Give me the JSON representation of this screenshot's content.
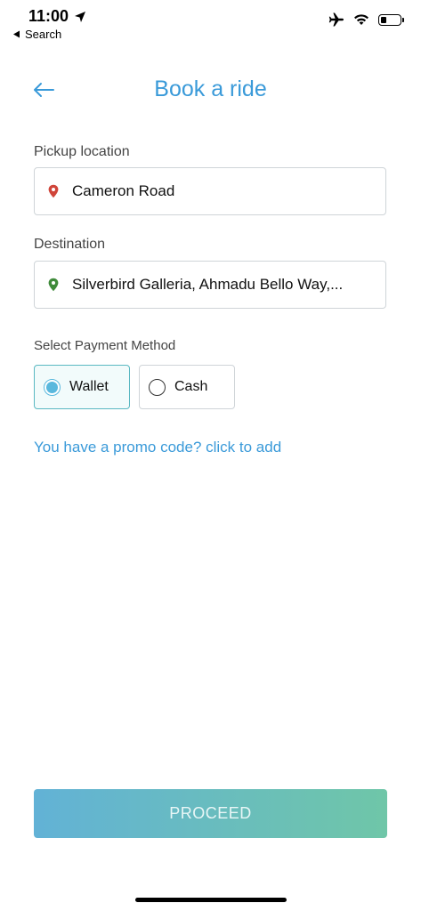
{
  "status_bar": {
    "time": "11:00",
    "back_app_label": "Search",
    "battery_level": 0.3
  },
  "header": {
    "title": "Book a ride"
  },
  "pickup": {
    "label": "Pickup location",
    "value": "Cameron Road",
    "pin_color": "#d0453a"
  },
  "destination": {
    "label": "Destination",
    "value": "Silverbird Galleria, Ahmadu Bello Way,...",
    "pin_color": "#3f8a3a"
  },
  "payment": {
    "label": "Select Payment Method",
    "options": [
      {
        "label": "Wallet",
        "selected": true
      },
      {
        "label": "Cash",
        "selected": false
      }
    ]
  },
  "promo": {
    "link_text": "You have a promo code? click to add"
  },
  "actions": {
    "proceed_label": "PROCEED"
  },
  "colors": {
    "accent": "#3a9ad9",
    "gradient_start": "#62b2d6",
    "gradient_end": "#6fc6a8"
  }
}
